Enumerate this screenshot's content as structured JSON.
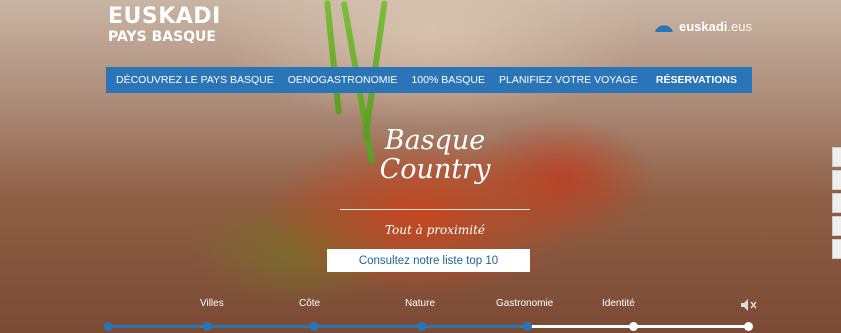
{
  "logo": {
    "line1": "EUSKADI",
    "line2": "PAYS BASQUE"
  },
  "brand": {
    "name": "euskadi",
    "domain": ".eus",
    "icon": "euskadi-logo-icon"
  },
  "nav": [
    "DÉCOUVREZ LE PAYS BASQUE",
    "OENOGASTRONOMIE",
    "100% BASQUE",
    "PLANIFIEZ VOTRE VOYAGE",
    "RÉSERVATIONS"
  ],
  "hero": {
    "title_line1": "Basque",
    "title_line2": "Country",
    "tagline": "Tout à proximité",
    "cta": "Consultez notre liste top 10"
  },
  "categories": [
    "Villes",
    "Côte",
    "Nature",
    "Gastronomie",
    "Identité"
  ],
  "mute_icon": "mute-speaker-icon",
  "colors": {
    "accent": "#2a74b8",
    "cta_text": "#1f5f9e"
  },
  "progress": 0.66
}
